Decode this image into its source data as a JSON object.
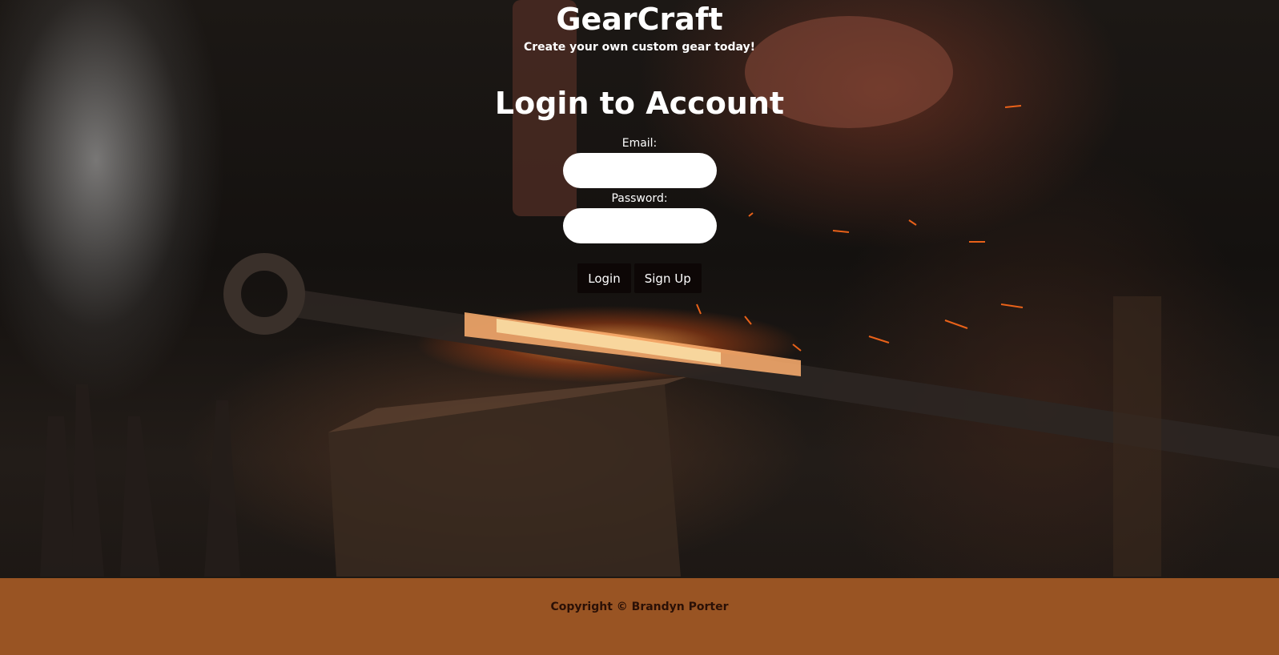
{
  "site": {
    "brand": "GearCraft",
    "tagline": "Create your own custom gear today!"
  },
  "login": {
    "title": "Login to Account",
    "email_label": "Email:",
    "email_value": "",
    "password_label": "Password:",
    "password_value": "",
    "login_button": "Login",
    "signup_button": "Sign Up"
  },
  "footer": {
    "copyright": "Copyright © Brandyn Porter"
  },
  "colors": {
    "footer_bg": "#995423",
    "button_bg": "#0d0706",
    "text": "#ffffff"
  },
  "background": {
    "icon": "forge-photo"
  }
}
